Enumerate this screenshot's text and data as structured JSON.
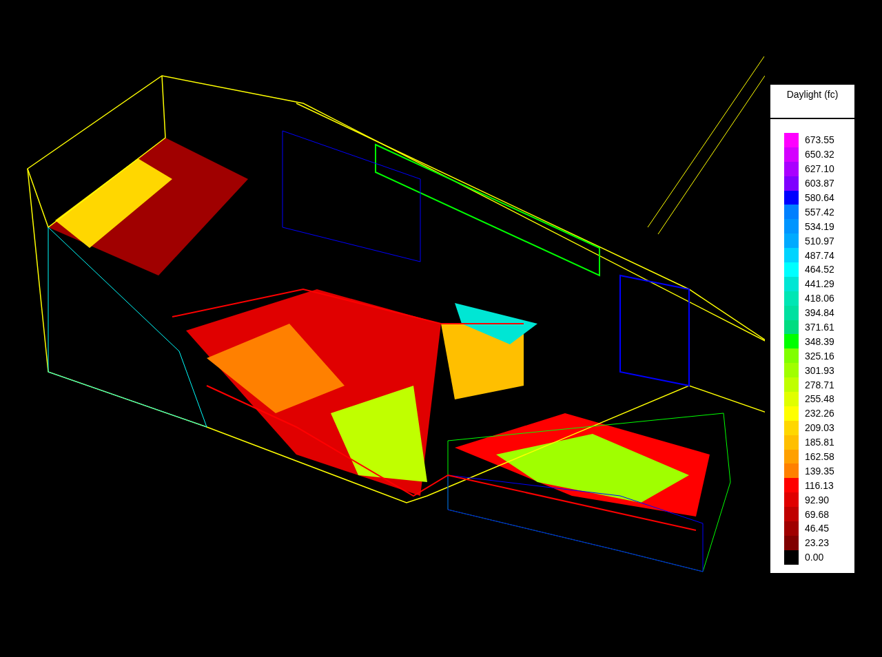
{
  "legend": {
    "title": "Daylight (fc)",
    "items": [
      {
        "label": "673.55",
        "color": "#ff00ff"
      },
      {
        "label": "650.32",
        "color": "#d400ff"
      },
      {
        "label": "627.10",
        "color": "#aa00ff"
      },
      {
        "label": "603.87",
        "color": "#7f00ff"
      },
      {
        "label": "580.64",
        "color": "#0000ff"
      },
      {
        "label": "557.42",
        "color": "#0080ff"
      },
      {
        "label": "534.19",
        "color": "#0095ff"
      },
      {
        "label": "510.97",
        "color": "#00aaff"
      },
      {
        "label": "487.74",
        "color": "#00d4ff"
      },
      {
        "label": "464.52",
        "color": "#00ffff"
      },
      {
        "label": "441.29",
        "color": "#00e6d4"
      },
      {
        "label": "418.06",
        "color": "#00e6b4"
      },
      {
        "label": "394.84",
        "color": "#00e0a0"
      },
      {
        "label": "371.61",
        "color": "#00dc80"
      },
      {
        "label": "348.39",
        "color": "#00ff00"
      },
      {
        "label": "325.16",
        "color": "#80ff00"
      },
      {
        "label": "301.93",
        "color": "#a0ff00"
      },
      {
        "label": "278.71",
        "color": "#c0ff00"
      },
      {
        "label": "255.48",
        "color": "#e0ff00"
      },
      {
        "label": "232.26",
        "color": "#ffff00"
      },
      {
        "label": "209.03",
        "color": "#ffd700"
      },
      {
        "label": "185.81",
        "color": "#ffbf00"
      },
      {
        "label": "162.58",
        "color": "#ffa000"
      },
      {
        "label": "139.35",
        "color": "#ff8000"
      },
      {
        "label": "116.13",
        "color": "#ff0000"
      },
      {
        "label": "92.90",
        "color": "#e00000"
      },
      {
        "label": "69.68",
        "color": "#c00000"
      },
      {
        "label": "46.45",
        "color": "#a00000"
      },
      {
        "label": "23.23",
        "color": "#800000"
      },
      {
        "label": "0.00",
        "color": "#000000"
      }
    ]
  }
}
